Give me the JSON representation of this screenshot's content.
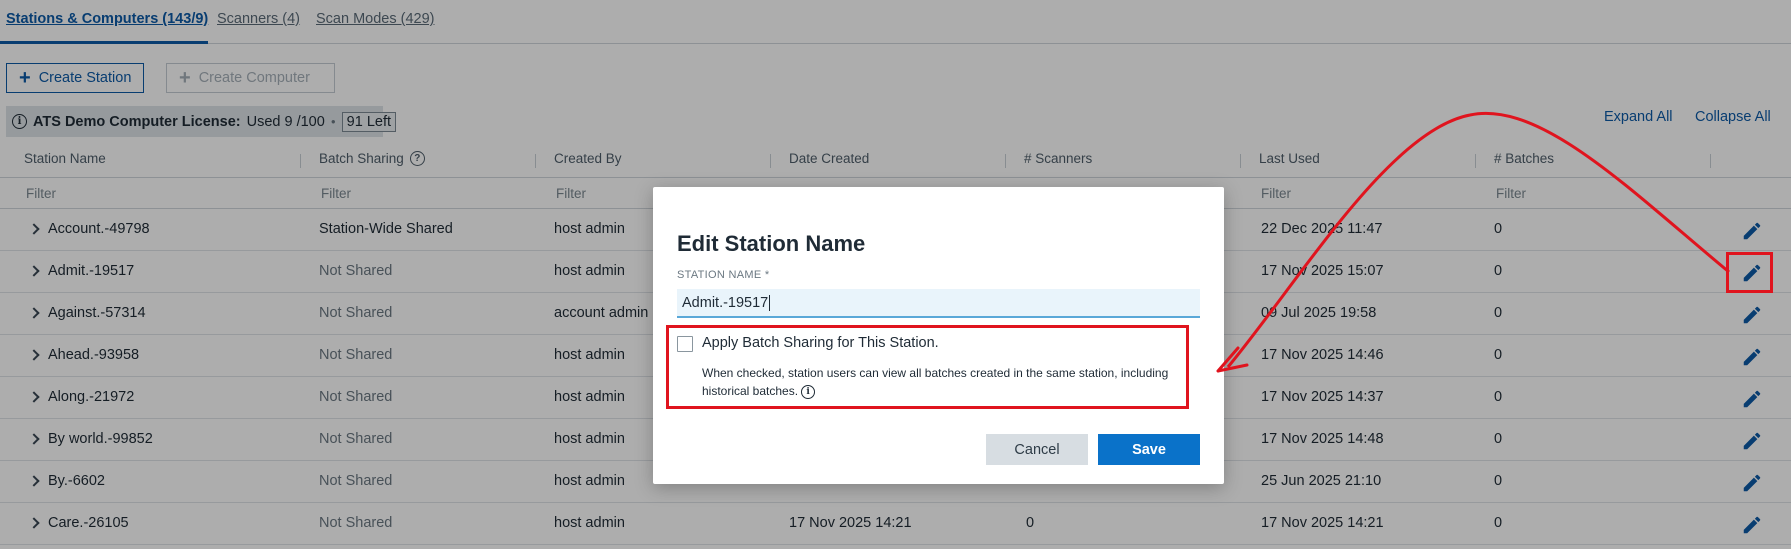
{
  "tabs": [
    {
      "label": "Stations & Computers (143/9)",
      "active": true
    },
    {
      "label": "Scanners (4)",
      "active": false
    },
    {
      "label": "Scan Modes (429)",
      "active": false
    }
  ],
  "toolbar": {
    "create_station": "Create Station",
    "create_computer": "Create Computer"
  },
  "license": {
    "label": "ATS Demo Computer License:",
    "used": "Used 9 /100",
    "left": "91 Left"
  },
  "links": {
    "expand_all": "Expand All",
    "collapse_all": "Collapse All"
  },
  "table": {
    "columns": [
      "Station Name",
      "Batch Sharing",
      "Created By",
      "Date Created",
      "# Scanners",
      "Last Used",
      "# Batches"
    ],
    "filter_placeholder": "Filter",
    "rows": [
      {
        "name": "Account.-49798",
        "sharing": "Station-Wide Shared",
        "created_by": "host admin",
        "date_created": "",
        "scanners": "",
        "last_used": "22 Dec 2025 11:47",
        "batches": "0"
      },
      {
        "name": "Admit.-19517",
        "sharing": "Not Shared",
        "created_by": "host admin",
        "date_created": "",
        "scanners": "",
        "last_used": "17 Nov 2025 15:07",
        "batches": "0"
      },
      {
        "name": "Against.-57314",
        "sharing": "Not Shared",
        "created_by": "account admin",
        "date_created": "",
        "scanners": "",
        "last_used": "09 Jul 2025 19:58",
        "batches": "0"
      },
      {
        "name": "Ahead.-93958",
        "sharing": "Not Shared",
        "created_by": "host admin",
        "date_created": "",
        "scanners": "",
        "last_used": "17 Nov 2025 14:46",
        "batches": "0"
      },
      {
        "name": "Along.-21972",
        "sharing": "Not Shared",
        "created_by": "host admin",
        "date_created": "",
        "scanners": "",
        "last_used": "17 Nov 2025 14:37",
        "batches": "0"
      },
      {
        "name": "By world.-99852",
        "sharing": "Not Shared",
        "created_by": "host admin",
        "date_created": "",
        "scanners": "",
        "last_used": "17 Nov 2025 14:48",
        "batches": "0"
      },
      {
        "name": "By.-6602",
        "sharing": "Not Shared",
        "created_by": "host admin",
        "date_created": "",
        "scanners": "",
        "last_used": "25 Jun 2025 21:10",
        "batches": "0"
      },
      {
        "name": "Care.-26105",
        "sharing": "Not Shared",
        "created_by": "host admin",
        "date_created": "17 Nov 2025 14:21",
        "scanners": "0",
        "last_used": "17 Nov 2025 14:21",
        "batches": "0"
      }
    ]
  },
  "modal": {
    "title": "Edit Station Name",
    "field_label": "STATION NAME *",
    "field_value": "Admit.-19517",
    "checkbox_label": "Apply Batch Sharing for This Station.",
    "checkbox_help": "When checked, station users can view all batches created in the same station, including historical batches.",
    "cancel": "Cancel",
    "save": "Save"
  },
  "colors": {
    "accent": "#0d5aa7",
    "save": "#0a72c9",
    "annotation": "#e0141e"
  }
}
